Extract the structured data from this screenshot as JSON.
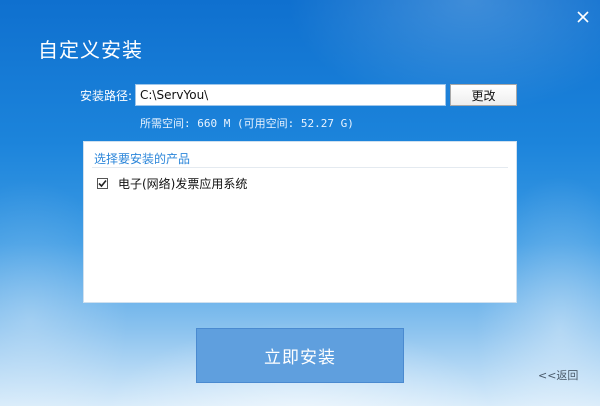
{
  "window": {
    "title": "自定义安装"
  },
  "install_path": {
    "label": "安装路径:",
    "value": "C:\\ServYou\\",
    "change_button": "更改",
    "space_info": "所需空间: 660 M (可用空间: 52.27 G)"
  },
  "products": {
    "title": "选择要安装的产品",
    "items": [
      {
        "label": "电子(网络)发票应用系统",
        "checked": true
      }
    ]
  },
  "footer": {
    "install_button": "立即安装",
    "back_link": "<<返回"
  },
  "colors": {
    "accent": "#2b86da",
    "install_button": "#5f9fde",
    "background_top": "#0f70cf"
  },
  "icons": [
    "close-icon",
    "checkmark-icon"
  ]
}
